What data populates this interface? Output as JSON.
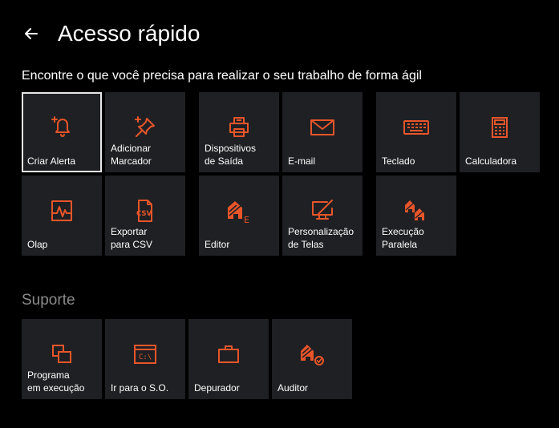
{
  "header": {
    "title": "Acesso rápido",
    "back_icon": "arrow-left-icon"
  },
  "subtitle": "Encontre o que você precisa para realizar o seu trabalho de forma ágil",
  "accent_color": "#e8552a",
  "tiles": [
    {
      "label": "Criar Alerta",
      "icon": "bell-add-icon"
    },
    {
      "label": "Adicionar\nMarcador",
      "icon": "pin-add-icon"
    },
    {
      "label": "Dispositivos\nde Saída",
      "icon": "printer-icon"
    },
    {
      "label": "E-mail",
      "icon": "envelope-icon"
    },
    {
      "label": "Teclado",
      "icon": "keyboard-icon"
    },
    {
      "label": "Calculadora",
      "icon": "calculator-icon"
    },
    {
      "label": "Olap",
      "icon": "chart-window-icon"
    },
    {
      "label": "Exportar\npara CSV",
      "icon": "csv-file-icon"
    },
    {
      "label": "Editor",
      "icon": "editor-icon"
    },
    {
      "label": "Personalização\nde Telas",
      "icon": "screen-edit-icon"
    },
    {
      "label": "Execução\nParalela",
      "icon": "parallel-run-icon"
    }
  ],
  "support": {
    "title": "Suporte",
    "tiles": [
      {
        "label": "Programa\nem execução",
        "icon": "windows-stack-icon"
      },
      {
        "label": "Ir para o S.O.",
        "icon": "command-prompt-icon"
      },
      {
        "label": "Depurador",
        "icon": "briefcase-icon"
      },
      {
        "label": "Auditor",
        "icon": "audit-check-icon"
      }
    ]
  },
  "command_prompt_text": "C:\\"
}
